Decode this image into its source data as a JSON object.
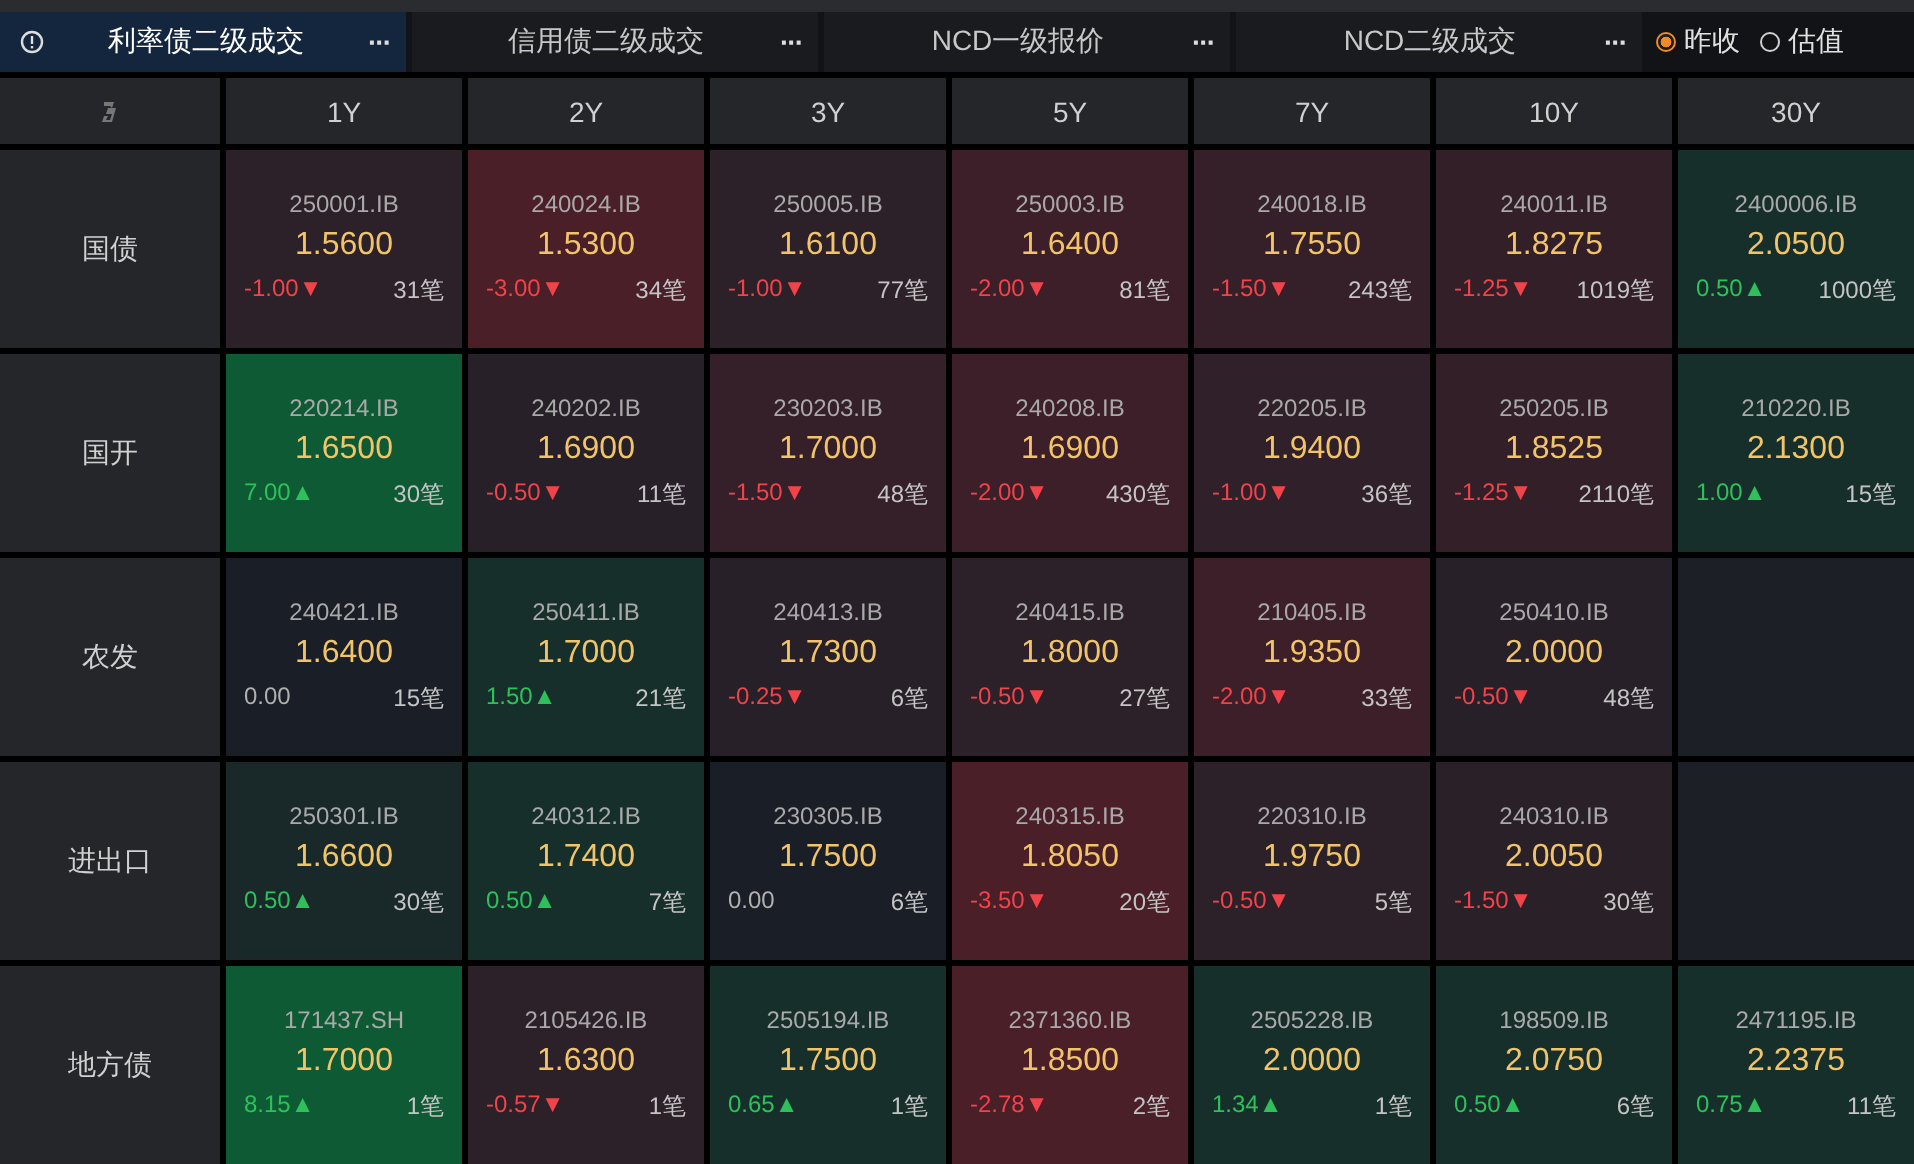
{
  "tabs": [
    {
      "label": "利率债二级成交",
      "selected": true,
      "more": "···"
    },
    {
      "label": "信用债二级成交",
      "selected": false,
      "more": "···"
    },
    {
      "label": "NCD一级报价",
      "selected": false,
      "more": "···"
    },
    {
      "label": "NCD二级成交",
      "selected": false,
      "more": "···"
    }
  ],
  "price_basis": [
    {
      "label": "昨收",
      "selected": true
    },
    {
      "label": "估值",
      "selected": false
    }
  ],
  "columns": [
    "1Y",
    "2Y",
    "3Y",
    "5Y",
    "7Y",
    "10Y",
    "30Y"
  ],
  "rows": [
    {
      "label": "国债",
      "cells": [
        {
          "code": "250001.IB",
          "yield": "1.5600",
          "change": "-1.00▼",
          "trades": "31笔",
          "kind": "down",
          "color": "#2c2029"
        },
        {
          "code": "240024.IB",
          "yield": "1.5300",
          "change": "-3.00▼",
          "trades": "34笔",
          "kind": "down",
          "color": "#4a1f27"
        },
        {
          "code": "250005.IB",
          "yield": "1.6100",
          "change": "-1.00▼",
          "trades": "77笔",
          "kind": "down",
          "color": "#2c2029"
        },
        {
          "code": "250003.IB",
          "yield": "1.6400",
          "change": "-2.00▼",
          "trades": "81笔",
          "kind": "down",
          "color": "#3c1f28"
        },
        {
          "code": "240018.IB",
          "yield": "1.7550",
          "change": "-1.50▼",
          "trades": "243笔",
          "kind": "down",
          "color": "#351f28"
        },
        {
          "code": "240011.IB",
          "yield": "1.8275",
          "change": "-1.25▼",
          "trades": "1019笔",
          "kind": "down",
          "color": "#321f28"
        },
        {
          "code": "2400006.IB",
          "yield": "2.0500",
          "change": "0.50▲",
          "trades": "1000笔",
          "kind": "up",
          "color": "#172f2a"
        }
      ]
    },
    {
      "label": "国开",
      "cells": [
        {
          "code": "220214.IB",
          "yield": "1.6500",
          "change": "7.00▲",
          "trades": "30笔",
          "kind": "up",
          "color": "#0e5a34"
        },
        {
          "code": "240202.IB",
          "yield": "1.6900",
          "change": "-0.50▼",
          "trades": "11笔",
          "kind": "down",
          "color": "#282028"
        },
        {
          "code": "230203.IB",
          "yield": "1.7000",
          "change": "-1.50▼",
          "trades": "48笔",
          "kind": "down",
          "color": "#351f28"
        },
        {
          "code": "240208.IB",
          "yield": "1.6900",
          "change": "-2.00▼",
          "trades": "430笔",
          "kind": "down",
          "color": "#3c1f28"
        },
        {
          "code": "220205.IB",
          "yield": "1.9400",
          "change": "-1.00▼",
          "trades": "36笔",
          "kind": "down",
          "color": "#2f2029"
        },
        {
          "code": "250205.IB",
          "yield": "1.8525",
          "change": "-1.25▼",
          "trades": "2110笔",
          "kind": "down",
          "color": "#321f28"
        },
        {
          "code": "210220.IB",
          "yield": "2.1300",
          "change": "1.00▲",
          "trades": "15笔",
          "kind": "up",
          "color": "#172f2a"
        }
      ]
    },
    {
      "label": "农发",
      "cells": [
        {
          "code": "240421.IB",
          "yield": "1.6400",
          "change": "0.00",
          "trades": "15笔",
          "kind": "flat",
          "color": "#1a1f27"
        },
        {
          "code": "250411.IB",
          "yield": "1.7000",
          "change": "1.50▲",
          "trades": "21笔",
          "kind": "up",
          "color": "#172f2a"
        },
        {
          "code": "240413.IB",
          "yield": "1.7300",
          "change": "-0.25▼",
          "trades": "6笔",
          "kind": "down",
          "color": "#282028"
        },
        {
          "code": "240415.IB",
          "yield": "1.8000",
          "change": "-0.50▼",
          "trades": "27笔",
          "kind": "down",
          "color": "#2c2029"
        },
        {
          "code": "210405.IB",
          "yield": "1.9350",
          "change": "-2.00▼",
          "trades": "33笔",
          "kind": "down",
          "color": "#3c1f28"
        },
        {
          "code": "250410.IB",
          "yield": "2.0000",
          "change": "-0.50▼",
          "trades": "48笔",
          "kind": "down",
          "color": "#282028"
        },
        null
      ]
    },
    {
      "label": "进出口",
      "cells": [
        {
          "code": "250301.IB",
          "yield": "1.6600",
          "change": "0.50▲",
          "trades": "30笔",
          "kind": "up",
          "color": "#19292a"
        },
        {
          "code": "240312.IB",
          "yield": "1.7400",
          "change": "0.50▲",
          "trades": "7笔",
          "kind": "up",
          "color": "#172f2a"
        },
        {
          "code": "230305.IB",
          "yield": "1.7500",
          "change": "0.00",
          "trades": "6笔",
          "kind": "flat",
          "color": "#1a1f27"
        },
        {
          "code": "240315.IB",
          "yield": "1.8050",
          "change": "-3.50▼",
          "trades": "20笔",
          "kind": "down",
          "color": "#4a1f27"
        },
        {
          "code": "220310.IB",
          "yield": "1.9750",
          "change": "-0.50▼",
          "trades": "5笔",
          "kind": "down",
          "color": "#2c2029"
        },
        {
          "code": "240310.IB",
          "yield": "2.0050",
          "change": "-1.50▼",
          "trades": "30笔",
          "kind": "down",
          "color": "#2a2028"
        },
        null
      ]
    },
    {
      "label": "地方债",
      "cells": [
        {
          "code": "171437.SH",
          "yield": "1.7000",
          "change": "8.15▲",
          "trades": "1笔",
          "kind": "up",
          "color": "#0e5a34"
        },
        {
          "code": "2105426.IB",
          "yield": "1.6300",
          "change": "-0.57▼",
          "trades": "1笔",
          "kind": "down",
          "color": "#2c2029"
        },
        {
          "code": "2505194.IB",
          "yield": "1.7500",
          "change": "0.65▲",
          "trades": "1笔",
          "kind": "up",
          "color": "#172f2a"
        },
        {
          "code": "2371360.IB",
          "yield": "1.8500",
          "change": "-2.78▼",
          "trades": "2笔",
          "kind": "down",
          "color": "#4a1f27"
        },
        {
          "code": "2505228.IB",
          "yield": "2.0000",
          "change": "1.34▲",
          "trades": "1笔",
          "kind": "up",
          "color": "#172f2a"
        },
        {
          "code": "198509.IB",
          "yield": "2.0750",
          "change": "0.50▲",
          "trades": "6笔",
          "kind": "up",
          "color": "#172f2a"
        },
        {
          "code": "2471195.IB",
          "yield": "2.2375",
          "change": "0.75▲",
          "trades": "11笔",
          "kind": "up",
          "color": "#172f2a"
        }
      ]
    }
  ]
}
